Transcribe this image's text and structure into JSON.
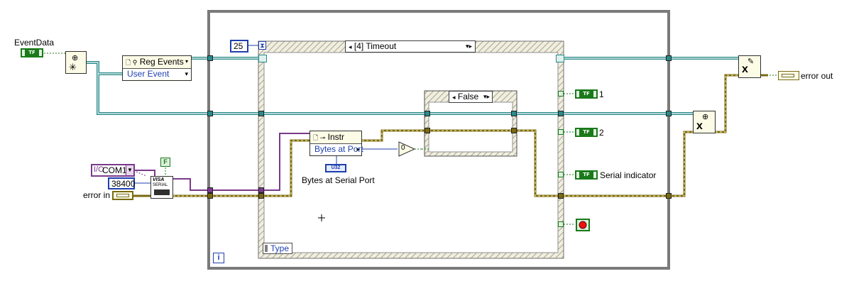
{
  "labels": {
    "event_data": "EventData",
    "error_in": "error in",
    "error_out": "error out",
    "bytes_at_serial_port": "Bytes at Serial Port",
    "indicator_1": "1",
    "indicator_2": "2",
    "serial_indicator": "Serial indicator"
  },
  "constants": {
    "timeout_ms": "25",
    "baud_rate": "38400",
    "visa_resource": "COM1",
    "false_const": "F",
    "zero": "0"
  },
  "event_structure": {
    "case_label": "[4] Timeout",
    "event_data_node": "Type"
  },
  "reg_events_node": {
    "title": "Reg Events",
    "item": "User Event"
  },
  "property_node": {
    "title": "Instr",
    "property": "Bytes at Port"
  },
  "case_structure": {
    "selector": "False"
  },
  "terminals": {
    "boolean_tag": "TF",
    "u32_tag": "U32",
    "visa_icon_text": "VISA",
    "serial_icon_text": "SERIAL",
    "loop_iteration": "i"
  },
  "colors": {
    "event_wire": "#2a8a8a",
    "error_wire": "#7a6a10",
    "visa_wire": "#7a3a8a",
    "numeric_wire": "#1f3fae",
    "boolean_wire": "#1a7a1a",
    "while_loop_frame": "#7a7a7a"
  }
}
